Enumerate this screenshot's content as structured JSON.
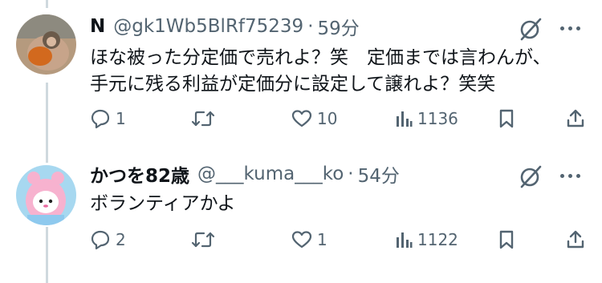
{
  "tweets": [
    {
      "name": "N",
      "handle": "@gk1Wb5BlRf75239",
      "separator": "·",
      "time": "59分",
      "body_lines": [
        "ほな被った分定価で売れよ？笑　定価までは言わんが、",
        "手元に残る利益が定価分に設定して譲れよ？笑笑"
      ],
      "replies": "1",
      "retweets": "",
      "likes": "10",
      "views": "1136",
      "colors": {
        "avatar_bg": "#a58a6d"
      }
    },
    {
      "name": "かつを82歳",
      "handle": "@___kuma___ko",
      "separator": "·",
      "time": "54分",
      "body_lines": [
        "ボランティアかよ"
      ],
      "replies": "2",
      "retweets": "",
      "likes": "1",
      "views": "1122",
      "colors": {
        "avatar_bg": "#a7d8f0"
      }
    }
  ],
  "icons": [
    "reply-icon",
    "retweet-icon",
    "like-icon",
    "views-icon",
    "bookmark-icon",
    "share-icon",
    "grok-icon",
    "more-icon"
  ],
  "colors": {
    "text": "#0f1419",
    "secondary": "#536471",
    "thread_line": "#cfd9de"
  }
}
